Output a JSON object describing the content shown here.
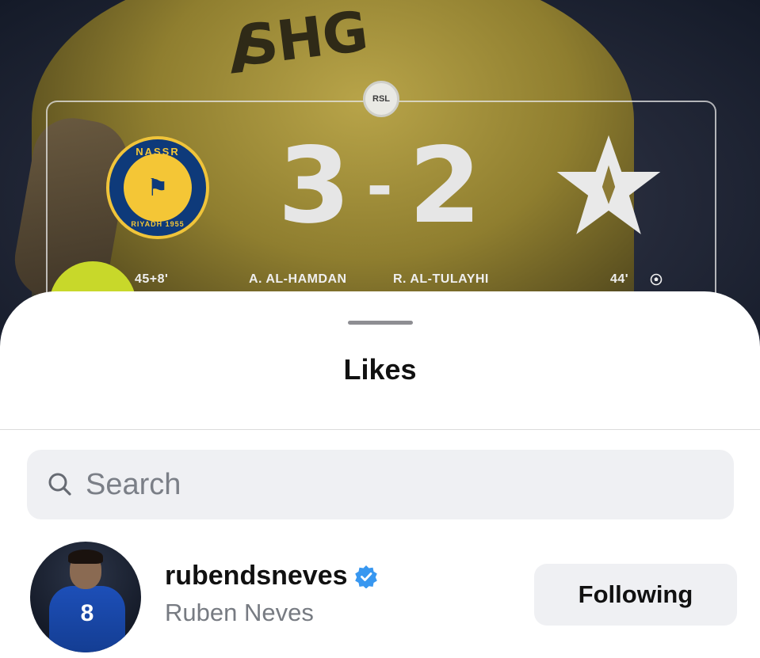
{
  "post_image": {
    "sponsor_text": "SHG",
    "league_badge": "RSL",
    "home_team": {
      "ring_top": "NASSR",
      "ring_bottom": "RIYADH 1955",
      "icon": "nassr-crest-icon",
      "scorer_minute": "45+8'"
    },
    "score": {
      "home": "3",
      "separator": "-",
      "away": "2"
    },
    "scorers": {
      "left": "A. AL-HAMDAN",
      "right": "R. AL-TULAYHI"
    },
    "away_team": {
      "icon": "star-crest-icon",
      "scorer_minute": "44'"
    },
    "colors": {
      "jersey": "#b8a449",
      "home_blue": "#0e3a7a",
      "home_gold": "#f4c636",
      "accent_lime": "#c8d82a"
    }
  },
  "sheet": {
    "title": "Likes",
    "search": {
      "placeholder": "Search",
      "value": ""
    },
    "users": [
      {
        "username": "rubendsneves",
        "full_name": "Ruben Neves",
        "verified": true,
        "avatar_shirt_number": "8",
        "follow_label": "Following"
      }
    ]
  },
  "colors": {
    "verified_blue": "#3897f0",
    "button_bg": "#eff0f3",
    "secondary_text": "#777b82"
  }
}
